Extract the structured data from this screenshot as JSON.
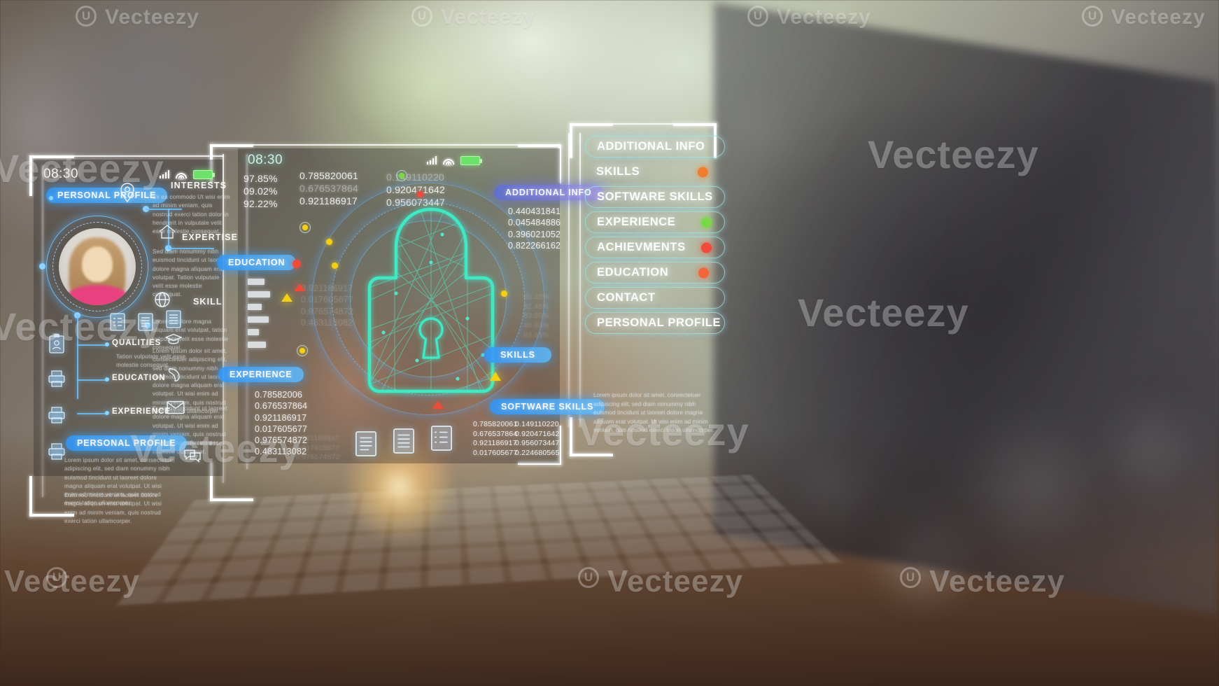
{
  "watermark": {
    "text": "Vecteezy",
    "logo_letter": "U"
  },
  "left_panel": {
    "status": {
      "clock": "08:30",
      "signal_icon": "signal-bars-icon",
      "wifi_icon": "wifi-icon",
      "battery_icon": "battery-icon"
    },
    "tag_top": "PERSONAL PROFILE",
    "tag_bottom": "PERSONAL PROFILE",
    "location_icon": "map-pin-icon",
    "avatar": "user-avatar",
    "sections": [
      {
        "title": "INTERESTS",
        "icon": "map-pin-icon",
        "text": "Ex ea commodo Ut wisi enim ad minim veniam, quis nostrud exerci tation dolor in hendrerit in vulputate velit esse molestie consequat."
      },
      {
        "title": "EXPERTISE",
        "icon": "home-icon",
        "text": "Sed diam nonummy nibh euismod tincidunt ut laoreet dolore magna aliquam erat volutpat. Tation vulputate velit esse molestie consequat."
      },
      {
        "title": "SKILL",
        "icon": "globe-icon",
        "text": "Laoreet dolore magna aliquam erat volutpat, tation vulputate velit esse molestie consequat."
      }
    ],
    "rows": [
      {
        "label": "QUALITIES",
        "icon": "graduation-cap-icon",
        "text": "Tation vulputate velit esse molestie consequat."
      },
      {
        "label": "EDUCATION",
        "icon": "phone-icon",
        "text": ""
      },
      {
        "label": "EXPERIENCE",
        "icon": "envelope-icon",
        "text": ""
      }
    ],
    "right_texts": [
      "Lorem ipsum dolor sit amet, consectetuer adipiscing elit, sed diam nonummy nibh euismod tincidunt ut laoreet dolore magna aliquam erat volutpat. Ut wisi enim ad minim veniam, quis nostrud exerci tation ullamcorper.",
      "Euismod tincidunt ut laoreet dolore magna aliquam erat volutpat. Ut wisi enim ad minim veniam, quis nostrud exerci tation ullamcorper.",
      "Tation vulputate velit esse molestie consequat."
    ],
    "footer_text": "Lorem ipsum dolor sit amet, consectetuer adipiscing elit, sed diam nonummy nibh euismod tincidunt ut laoreet dolore magna aliquam erat volutpat. Ut wisi enim ad minim veniam, quis nostrud exerci tation ullamcorper.",
    "footer_text2": "Euismod tincidunt ut laoreet dolore magna aliquam erat volutpat. Ut wisi enim ad minim veniam, quis nostrud exerci tation ullamcorper.",
    "doc_icons": [
      "document-checklist-icon",
      "document-lines-icon",
      "document-text-icon"
    ],
    "side_icons": [
      "clipboard-user-icon",
      "printer-icon",
      "printer-icon",
      "printer-icon"
    ],
    "chat_icon": "chat-bubbles-icon"
  },
  "middle_panel": {
    "status": {
      "clock": "08:30",
      "signal_icon": "signal-bars-icon",
      "wifi_icon": "wifi-icon",
      "battery_icon": "battery-icon"
    },
    "percentages": [
      "97.85%",
      "09.02%",
      "92.22%"
    ],
    "values_col1": [
      "0.785820061",
      "0.676537864",
      "0.921186917"
    ],
    "values_col2": [
      "0.149110220",
      "0.920471642",
      "0.956073447"
    ],
    "tag_education": "EDUCATION",
    "tag_experience": "EXPERIENCE",
    "tag_skills": "SKILLS",
    "tag_software_skills": "SOFTWARE SKILLS",
    "tag_additional_info": "ADDITIONAL INFO",
    "lower_values": [
      "0.78582006",
      "0.676537864",
      "0.921186917",
      "0.017605677",
      "0.976574872",
      "0.483113082"
    ],
    "lower_values_dim": [
      "0.921186917",
      "0.017605677",
      "0.976574872",
      "0.483113082"
    ],
    "bottom_col1": [
      "0.785820061",
      "0.676537864",
      "0.921186917",
      "0.017605677"
    ],
    "bottom_col2": [
      "0.149110220",
      "0.920471642",
      "0.956073447",
      "0.224680565"
    ],
    "side_values": [
      "0.440431841",
      "0.045484886",
      "0.396021052",
      "0.822266162"
    ],
    "faint_values": [
      "85.23%",
      "32.45%",
      "83.55%",
      "40.33%",
      "83.61%"
    ],
    "lock_icon": "padlock-wireframe-icon",
    "doc_icons": [
      "document-text-icon",
      "document-lines-icon",
      "document-checklist-icon"
    ]
  },
  "right_panel": {
    "menu_items": [
      {
        "label": "ADDITIONAL INFO",
        "boxed": true,
        "dot": null
      },
      {
        "label": "SKILLS",
        "boxed": false,
        "dot": "#f07c2e"
      },
      {
        "label": "SOFTWARE SKILLS",
        "boxed": true,
        "dot": null
      },
      {
        "label": "EXPERIENCE",
        "boxed": true,
        "dot": "#79d84a"
      },
      {
        "label": "ACHIEVMENTS",
        "boxed": true,
        "dot": "#ef4b3a"
      },
      {
        "label": "EDUCATION",
        "boxed": true,
        "dot": "#f0673a"
      },
      {
        "label": "CONTACT",
        "boxed": true,
        "dot": null
      },
      {
        "label": "PERSONAL PROFILE",
        "boxed": true,
        "dot": null
      }
    ],
    "description": "Lorem ipsum dolor sit amet, consectetuer adipiscing elit, sed diam nonummy nibh euismod tincidunt ut laoreet dolore magna aliquam erat volutpat. Ut wisi enim ad minim veniam, quis nostrud exerci tation ullamcorper."
  },
  "colors": {
    "accent_blue": "#3c9cf5",
    "accent_teal": "#3fe0c0",
    "dot_orange": "#f07c2e",
    "dot_green": "#79d84a",
    "dot_red": "#ef4b3a",
    "battery_green": "#6de26a"
  }
}
